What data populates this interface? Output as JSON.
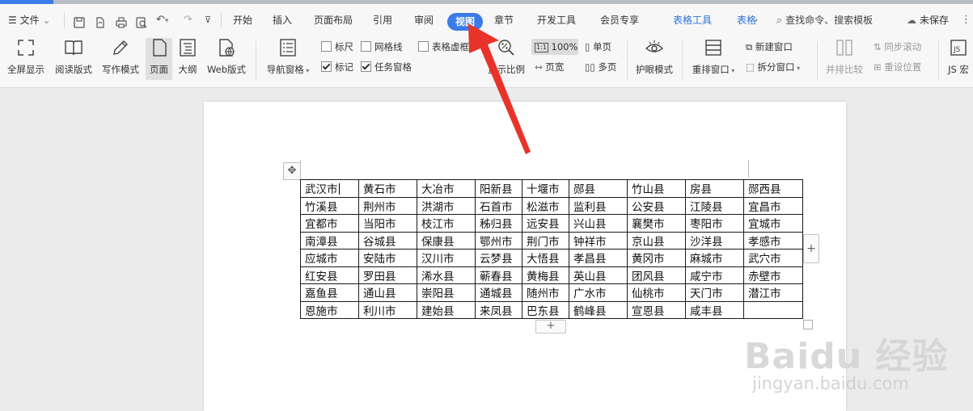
{
  "topstrip": {
    "segments": [
      {
        "color": "#3a7be8",
        "name": "tab-strip-active"
      },
      {
        "color": "#b9bcc4",
        "name": "tab-strip-1"
      },
      {
        "color": "#b9bcc4",
        "name": "tab-strip-2"
      },
      {
        "color": "#b9bcc4",
        "name": "tab-strip-3"
      }
    ]
  },
  "menubar": {
    "file_label": "文件",
    "tabs": [
      "开始",
      "插入",
      "页面布局",
      "引用",
      "审阅",
      "视图",
      "章节",
      "开发工具",
      "会员专享",
      "表格工具",
      "表格"
    ],
    "active_tab": "视图",
    "search_label": "查找命令、搜索模板",
    "unsaved_label": "未保存"
  },
  "ribbon": {
    "buttons": {
      "fullscreen": "全屏显示",
      "reading": "阅读版式",
      "writing": "写作模式",
      "page": "页面",
      "outline": "大纲",
      "web": "Web版式",
      "nav_pane": "导航窗格",
      "zoom_ratio": "显示比例",
      "eye_mode": "护眼模式",
      "arrange": "重排窗口",
      "compare": "并排比较",
      "js_macro": "JS 宏"
    },
    "checkboxes": [
      {
        "label": "标尺",
        "checked": false
      },
      {
        "label": "网格线",
        "checked": false
      },
      {
        "label": "表格虚框",
        "checked": false
      },
      {
        "label": "标记",
        "checked": true
      },
      {
        "label": "任务窗格",
        "checked": true
      }
    ],
    "zoom_value": "100%",
    "single_page": "单页",
    "page_width": "页宽",
    "multi_page": "多页",
    "new_window": "新建窗口",
    "split_window": "拆分窗口",
    "sync_scroll": "同步滚动",
    "reset_position": "重设位置"
  },
  "table": {
    "rows": [
      [
        "武汉市",
        "黄石市",
        "大冶市",
        "阳新县",
        "十堰市",
        "郧县",
        "竹山县",
        "房县",
        "郧西县"
      ],
      [
        "竹溪县",
        "荆州市",
        "洪湖市",
        "石首市",
        "松滋市",
        "监利县",
        "公安县",
        "江陵县",
        "宜昌市"
      ],
      [
        "宜都市",
        "当阳市",
        "枝江市",
        "秭归县",
        "远安县",
        "兴山县",
        "襄樊市",
        "枣阳市",
        "宜城市"
      ],
      [
        "南漳县",
        "谷城县",
        "保康县",
        "鄂州市",
        "荆门市",
        "钟祥市",
        "京山县",
        "沙洋县",
        "孝感市"
      ],
      [
        "应城市",
        "安陆市",
        "汉川市",
        "云梦县",
        "大悟县",
        "孝昌县",
        "黄冈市",
        "麻城市",
        "武穴市"
      ],
      [
        "红安县",
        "罗田县",
        "浠水县",
        "蕲春县",
        "黄梅县",
        "英山县",
        "团风县",
        "咸宁市",
        "赤壁市"
      ],
      [
        "嘉鱼县",
        "通山县",
        "崇阳县",
        "通城县",
        "随州市",
        "广水市",
        "仙桃市",
        "天门市",
        "潜江市"
      ],
      [
        "恩施市",
        "利川市",
        "建始县",
        "来凤县",
        "巴东县",
        "鹤峰县",
        "宣恩县",
        "咸丰县",
        ""
      ]
    ]
  },
  "watermark": {
    "big": "Baidu 经验",
    "small": "jingyan.baidu.com"
  },
  "colors": {
    "accent": "#3a7be8",
    "arrow": "#e8332a",
    "table_tools": "#2f6fd6"
  }
}
